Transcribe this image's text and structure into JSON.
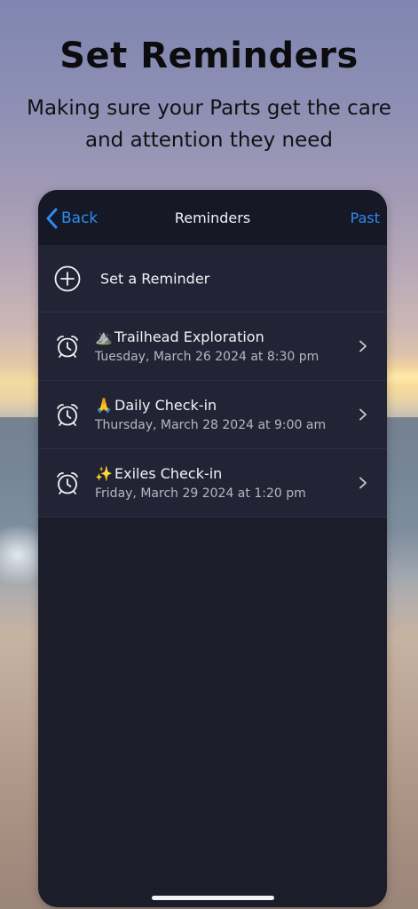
{
  "promo": {
    "headline": "Set Reminders",
    "subhead": "Making sure your Parts get the care and attention they need"
  },
  "navbar": {
    "back_label": "Back",
    "title": "Reminders",
    "past_label": "Past"
  },
  "add_row": {
    "label": "Set a Reminder",
    "icon": "plus-circle-icon"
  },
  "reminders": [
    {
      "emoji": "⛰️",
      "title": "Trailhead Exploration",
      "when": "Tuesday, March 26 2024 at 8:30 pm",
      "icon": "alarm-clock-icon"
    },
    {
      "emoji": "🙏",
      "title": "Daily Check-in",
      "when": "Thursday, March 28 2024 at 9:00 am",
      "icon": "alarm-clock-icon"
    },
    {
      "emoji": "✨",
      "title": "Exiles Check-in",
      "when": "Friday, March 29 2024 at 1:20 pm",
      "icon": "alarm-clock-icon"
    }
  ],
  "colors": {
    "accent": "#2d8cf0",
    "panel": "#1b1d2a",
    "row": "#222436"
  }
}
